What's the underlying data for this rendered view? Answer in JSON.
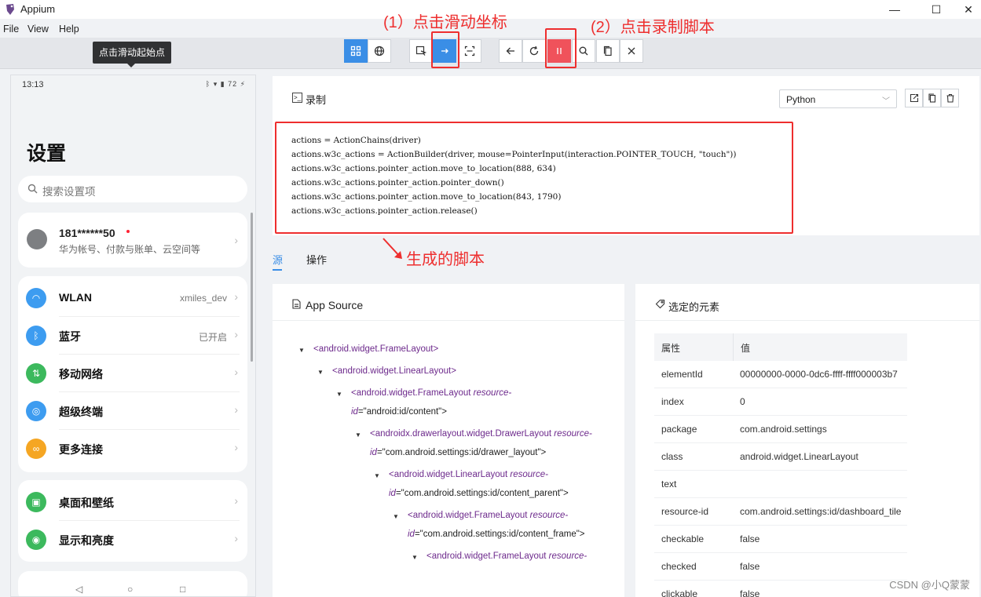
{
  "app": {
    "title": "Appium"
  },
  "window_controls": {
    "minimize": "—",
    "maximize": "☐",
    "close": "✕"
  },
  "menu": [
    "File",
    "View",
    "Help"
  ],
  "tooltip": "点击滑动起始点",
  "annotations": {
    "step1": "(1）点击滑动坐标",
    "step2": "(2）点击录制脚本",
    "generated": "生成的脚本"
  },
  "phone": {
    "status_time": "13:13",
    "status_right": "ᛒ ▾ ▮ 72 ⚡",
    "title": "设置",
    "search_placeholder": "搜索设置项",
    "account": {
      "name": "181******50",
      "sub": "华为帐号、付款与账单、云空间等"
    },
    "group1": [
      {
        "label": "WLAN",
        "value": "xmiles_dev",
        "icon": "wifi-icon",
        "color": "#3d9cf0"
      },
      {
        "label": "蓝牙",
        "value": "已开启",
        "icon": "bluetooth-icon",
        "color": "#3d9cf0"
      },
      {
        "label": "移动网络",
        "value": "",
        "icon": "cellular-icon",
        "color": "#3cb95d"
      },
      {
        "label": "超级终端",
        "value": "",
        "icon": "super-device-icon",
        "color": "#3d9cf0"
      },
      {
        "label": "更多连接",
        "value": "",
        "icon": "link-icon",
        "color": "#f5a623"
      }
    ],
    "group2": [
      {
        "label": "桌面和壁纸",
        "value": "",
        "icon": "wallpaper-icon",
        "color": "#3cb95d"
      },
      {
        "label": "显示和亮度",
        "value": "",
        "icon": "eye-icon",
        "color": "#3cb95d"
      }
    ]
  },
  "recorder": {
    "title": "录制",
    "language": "Python",
    "code_lines": [
      "actions = ActionChains(driver)",
      "actions.w3c_actions = ActionBuilder(driver, mouse=PointerInput(interaction.POINTER_TOUCH, \"touch\"))",
      "actions.w3c_actions.pointer_action.move_to_location(888, 634)",
      "actions.w3c_actions.pointer_action.pointer_down()",
      "actions.w3c_actions.pointer_action.move_to_location(843, 1790)",
      "actions.w3c_actions.pointer_action.release()"
    ]
  },
  "tabs": [
    "源",
    "操作"
  ],
  "app_source": {
    "title": "App Source",
    "nodes": [
      {
        "tag": "<android.widget.FrameLayout>",
        "attr": "",
        "attr_cont": "",
        "value": ""
      },
      {
        "tag": "<android.widget.LinearLayout>",
        "attr": "",
        "attr_cont": "",
        "value": ""
      },
      {
        "tag": "<android.widget.FrameLayout ",
        "attr": "resource-",
        "attr_cont": "id",
        "value": "=\"android:id/content\">"
      },
      {
        "tag": "<androidx.drawerlayout.widget.DrawerLayout ",
        "attr": "resource-",
        "attr_cont": "id",
        "value": "=\"com.android.settings:id/drawer_layout\">"
      },
      {
        "tag": "<android.widget.LinearLayout ",
        "attr": "resource-",
        "attr_cont": "id",
        "value": "=\"com.android.settings:id/content_parent\">"
      },
      {
        "tag": "<android.widget.FrameLayout ",
        "attr": "resource-",
        "attr_cont": "id",
        "value": "=\"com.android.settings:id/content_frame\">"
      },
      {
        "tag": "<android.widget.FrameLayout ",
        "attr": "resource-",
        "attr_cont": "",
        "value": ""
      }
    ]
  },
  "selected": {
    "title": "选定的元素",
    "col_attr": "属性",
    "col_value": "值",
    "props": [
      {
        "k": "elementId",
        "v": "00000000-0000-0dc6-ffff-ffff000003b7"
      },
      {
        "k": "index",
        "v": "0"
      },
      {
        "k": "package",
        "v": "com.android.settings"
      },
      {
        "k": "class",
        "v": "android.widget.LinearLayout"
      },
      {
        "k": "text",
        "v": ""
      },
      {
        "k": "resource-id",
        "v": "com.android.settings:id/dashboard_tile"
      },
      {
        "k": "checkable",
        "v": "false"
      },
      {
        "k": "checked",
        "v": "false"
      },
      {
        "k": "clickable",
        "v": "false"
      }
    ]
  },
  "watermark": "CSDN @小Q蒙蒙"
}
